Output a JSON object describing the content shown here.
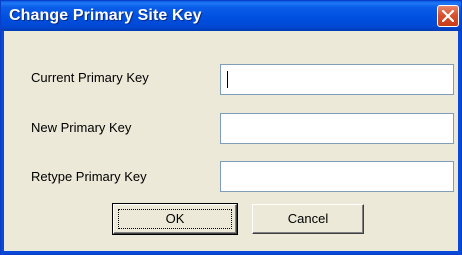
{
  "window": {
    "title": "Change Primary Site Key",
    "close_icon": "close-icon"
  },
  "form": {
    "fields": [
      {
        "label": "Current Primary Key",
        "value": "",
        "focused": true
      },
      {
        "label": "New Primary Key",
        "value": ""
      },
      {
        "label": "Retype Primary Key",
        "value": ""
      }
    ]
  },
  "buttons": {
    "ok_label": "OK",
    "cancel_label": "Cancel"
  },
  "colors": {
    "titlebar": "#0050e0",
    "close_button": "#d9502e",
    "dialog_background": "#ece9d8"
  }
}
